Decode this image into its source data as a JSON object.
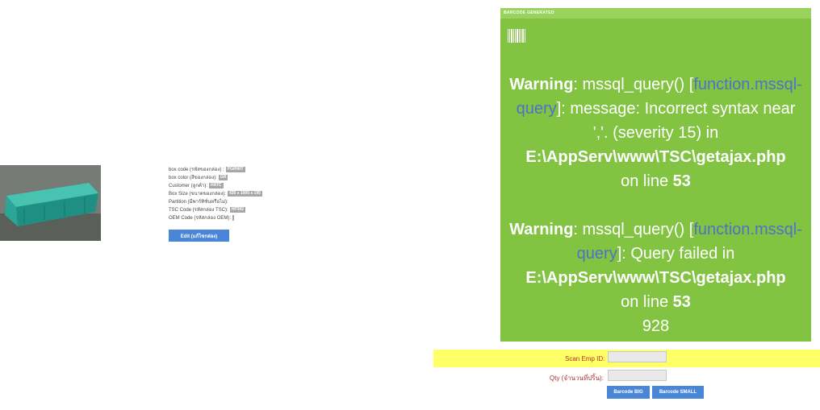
{
  "product": {
    "image_label": "green plastic crate photo",
    "fields": [
      {
        "label": "box code (รหัสของกล่อง) :",
        "value": "PGRN07"
      },
      {
        "label": "box color (สีของกล่อง):",
        "value": "GR"
      },
      {
        "label": "Customer (ลูกค้า):",
        "value": "HATC"
      },
      {
        "label": "Box Size (ขนาดของกล่อง):",
        "value": "435 x 1005 x 195"
      },
      {
        "label": "Partition (มีพาร์ทิชั่นหรือไม่):",
        "value": ""
      },
      {
        "label": "TSC Code (รหัสกล่อง TSC):",
        "value": "HP392"
      },
      {
        "label": "OEM Code (รหัสกล่อง OEM):",
        "value": ""
      }
    ],
    "edit_label": "Edit (แก้ไขกล่อง)"
  },
  "panel": {
    "header": "BARCODE GENERATED",
    "warning1": {
      "word": "Warning",
      "pre": ": mssql_query() [",
      "link": "function.mssql-query",
      "post": "]: message: Incorrect syntax near ','. (severity 15) in",
      "path": "E:\\AppServ\\www\\TSC\\getajax.php",
      "online": "on line",
      "line": "53"
    },
    "warning2": {
      "word": "Warning",
      "pre": ": mssql_query() [",
      "link": "function.mssql-query",
      "post": "]: Query failed in",
      "path": "E:\\AppServ\\www\\TSC\\getajax.php",
      "online": "on line",
      "line": "53"
    },
    "result": "928"
  },
  "form": {
    "scan_label": "Scan Emp ID:",
    "qty_label": "Qty (จำนวนที่ปริ้น):",
    "big_label": "Barcode BIG",
    "small_label": "Barcode SMALL"
  },
  "colors": {
    "panel": "#82c341",
    "panel_header": "#9ad25e",
    "button": "#4a86d8",
    "scan_bar": "#ffff66",
    "link": "#4d72c9"
  }
}
